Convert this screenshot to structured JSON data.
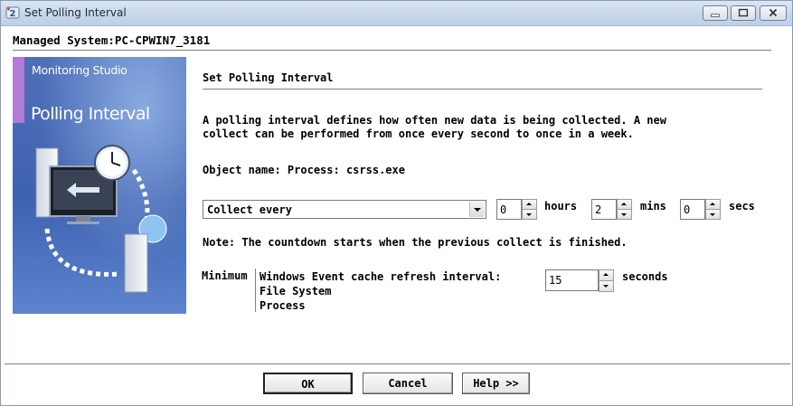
{
  "window": {
    "title": "Set Polling Interval",
    "icon": "polling-app-icon",
    "controls": [
      "minimize-icon",
      "maximize-icon",
      "close-icon"
    ]
  },
  "header": {
    "managed_system": "Managed System:PC-CPWIN7_3181"
  },
  "banner": {
    "subtitle": "Monitoring Studio",
    "title": "Polling Interval",
    "accent": "#b27bd6"
  },
  "section": {
    "title": "Set Polling Interval",
    "description": "A polling interval defines how often new data is being collected. A new\ncollect can be performed from once every second to once in a week.",
    "object_name": "Object name: Process: csrss.exe"
  },
  "interval": {
    "mode": "Collect every",
    "hours_value": "0",
    "hours_label": "hours",
    "mins_value": "2",
    "mins_label": "mins",
    "secs_value": "0",
    "secs_label": "secs"
  },
  "note": "Note: The countdown starts when the previous collect is finished.",
  "minimum": {
    "label": "Minimum",
    "lines": [
      "Windows Event cache refresh interval:",
      "File System",
      "Process"
    ],
    "value": "15",
    "unit": "seconds"
  },
  "buttons": {
    "ok": "OK",
    "cancel": "Cancel",
    "help": "Help >>"
  }
}
